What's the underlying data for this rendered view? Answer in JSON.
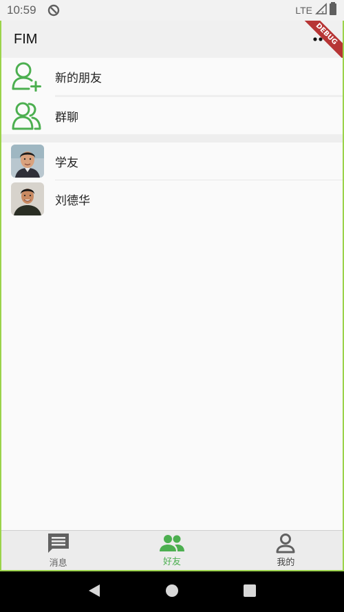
{
  "status_bar": {
    "time": "10:59",
    "network": "LTE"
  },
  "app_bar": {
    "title": "FIM",
    "debug_banner": "DEBUG"
  },
  "contacts": {
    "special": [
      {
        "label": "新的朋友",
        "icon": "add-person-icon"
      },
      {
        "label": "群聊",
        "icon": "group-icon"
      }
    ],
    "friends": [
      {
        "name": "学友"
      },
      {
        "name": "刘德华"
      }
    ]
  },
  "bottom_nav": {
    "items": [
      {
        "label": "消息",
        "icon": "message-icon",
        "active": false
      },
      {
        "label": "好友",
        "icon": "people-icon",
        "active": true
      },
      {
        "label": "我的",
        "icon": "person-icon",
        "active": false
      }
    ]
  },
  "colors": {
    "accent": "#4caf50",
    "inactive": "#616161"
  }
}
